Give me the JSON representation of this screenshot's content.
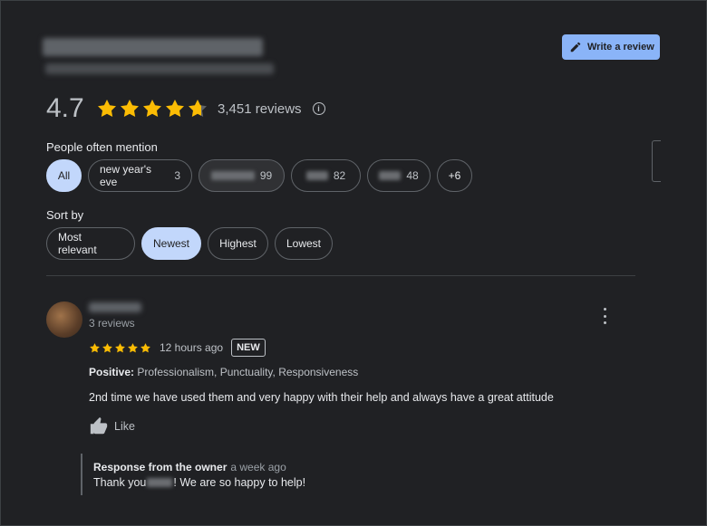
{
  "header": {
    "write_review_label": "Write a review"
  },
  "summary": {
    "rating": "4.7",
    "stars": 4.7,
    "reviews_count": "3,451 reviews",
    "star_color": "#fbbc04"
  },
  "mentions": {
    "label": "People often mention",
    "chips": [
      {
        "label": "All",
        "count": ""
      },
      {
        "label": "new year's eve",
        "count": "3"
      },
      {
        "label": "",
        "count": "99"
      },
      {
        "label": "",
        "count": "82"
      },
      {
        "label": "",
        "count": "48"
      },
      {
        "label": "+6",
        "count": ""
      }
    ]
  },
  "sort": {
    "label": "Sort by",
    "options": [
      "Most relevant",
      "Newest",
      "Highest",
      "Lowest"
    ],
    "selected": "Newest"
  },
  "review": {
    "reviewer_sub": "3 reviews",
    "stars": 5,
    "time": "12 hours ago",
    "badge": "NEW",
    "positive_label": "Positive:",
    "positive_text": " Professionalism, Punctuality, Responsiveness",
    "text": "2nd time we have used them and very happy with their help and always have a great attitude",
    "like_label": "Like",
    "response": {
      "title": "Response from the owner",
      "ago": "a week ago",
      "text_before": "Thank you",
      "text_after": "! We are so happy to help!"
    }
  },
  "colors": {
    "background": "#202124",
    "accent": "#8ab4f8",
    "chip_selected": "#c2d7fb"
  }
}
